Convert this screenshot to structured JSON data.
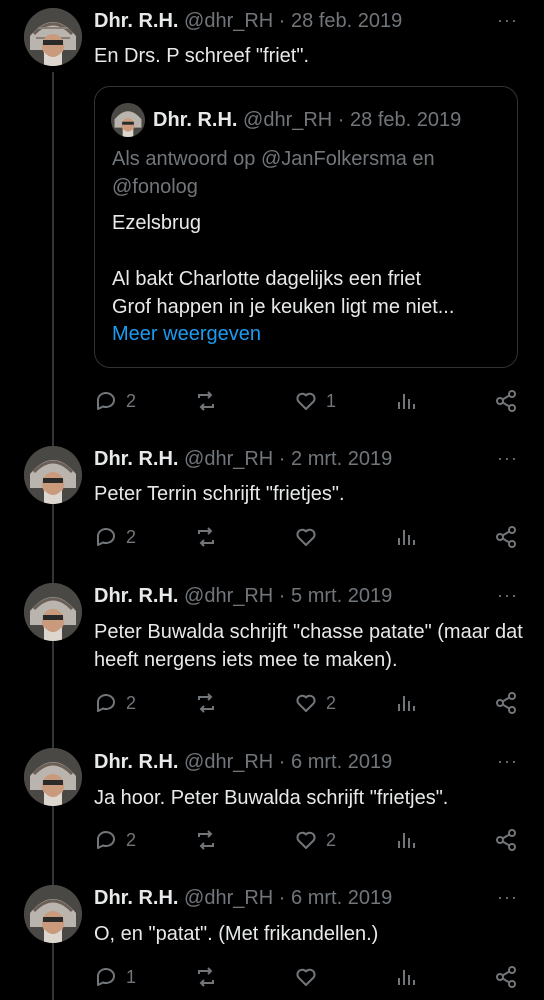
{
  "colors": {
    "background": "#000000",
    "text": "#e7e9ea",
    "muted": "#71767b",
    "link": "#1d9bf0",
    "border": "#2f3336"
  },
  "tweets": [
    {
      "name": "Dhr. R.H.",
      "handle": "@dhr_RH",
      "sep": "·",
      "date": "28 feb. 2019",
      "text": "En Drs. P schreef \"friet\".",
      "more": "···",
      "quote": {
        "name": "Dhr. R.H.",
        "handle": "@dhr_RH",
        "sep": "·",
        "date": "28 feb. 2019",
        "reply_to": "Als antwoord op @JanFolkersma en @fonolog",
        "text": "Ezelsbrug\n\nAl bakt Charlotte dagelijks een friet\nGrof happen in je keuken ligt me niet...",
        "show_more": "Meer weergeven"
      },
      "replies": "2",
      "retweets": "",
      "likes": "1",
      "views": ""
    },
    {
      "name": "Dhr. R.H.",
      "handle": "@dhr_RH",
      "sep": "·",
      "date": "2 mrt. 2019",
      "text": "Peter Terrin schrijft \"frietjes\".",
      "more": "···",
      "replies": "2",
      "retweets": "",
      "likes": "",
      "views": ""
    },
    {
      "name": "Dhr. R.H.",
      "handle": "@dhr_RH",
      "sep": "·",
      "date": "5 mrt. 2019",
      "text": "Peter Buwalda schrijft \"chasse patate\" (maar dat heeft nergens iets mee te maken).",
      "more": "···",
      "replies": "2",
      "retweets": "",
      "likes": "2",
      "views": ""
    },
    {
      "name": "Dhr. R.H.",
      "handle": "@dhr_RH",
      "sep": "·",
      "date": "6 mrt. 2019",
      "text": "Ja hoor. Peter Buwalda schrijft \"frietjes\".",
      "more": "···",
      "replies": "2",
      "retweets": "",
      "likes": "2",
      "views": ""
    },
    {
      "name": "Dhr. R.H.",
      "handle": "@dhr_RH",
      "sep": "·",
      "date": "6 mrt. 2019",
      "text": "O, en \"patat\". (Met frikandellen.)",
      "more": "···",
      "replies": "1",
      "retweets": "",
      "likes": "",
      "views": ""
    }
  ]
}
